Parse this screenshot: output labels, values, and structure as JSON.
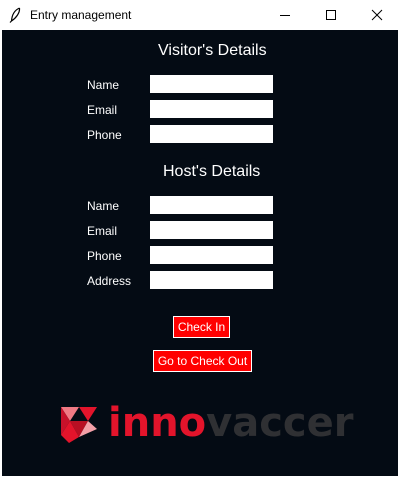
{
  "window": {
    "title": "Entry management",
    "icon": "feather-icon",
    "controls": [
      "minimize-icon",
      "maximize-icon",
      "close-icon"
    ]
  },
  "visitor": {
    "heading": "Visitor's Details",
    "fields": [
      {
        "label": "Name",
        "value": ""
      },
      {
        "label": "Email",
        "value": ""
      },
      {
        "label": "Phone",
        "value": ""
      }
    ]
  },
  "host": {
    "heading": "Host's Details",
    "fields": [
      {
        "label": "Name",
        "value": ""
      },
      {
        "label": "Email",
        "value": ""
      },
      {
        "label": "Phone",
        "value": ""
      },
      {
        "label": "Address",
        "value": ""
      }
    ]
  },
  "actions": {
    "check_in": "Check In",
    "check_out": "Go to Check Out"
  },
  "logo": {
    "wordmark_part1": "inno",
    "wordmark_part2": "vaccer",
    "brand_red": "#e3142b",
    "brand_dark": "#2f3033"
  },
  "colors": {
    "background": "#040b14",
    "button": "#ff0000",
    "text": "#ffffff"
  }
}
